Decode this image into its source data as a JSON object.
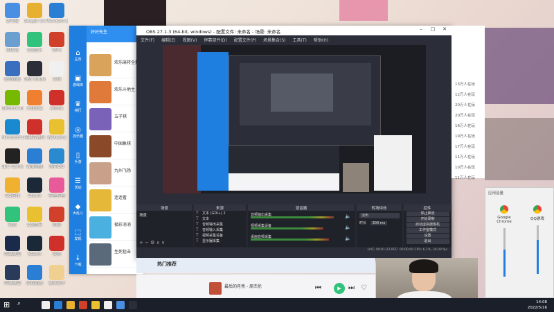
{
  "obs": {
    "title": "OBS 27.1.3 (64-bit, windows) - 配置文件: 未命名 - 场景: 未命名",
    "menu": [
      "文件(F)",
      "编辑(E)",
      "视图(V)",
      "停靠部件(D)",
      "配置文件(P)",
      "场景集合(S)",
      "工具(T)",
      "帮助(H)"
    ],
    "dock_headers": {
      "scenes": "场景",
      "sources": "来源",
      "mixer": "混音器",
      "transitions": "转场特效",
      "controls": "控件"
    },
    "scene_items": [
      "场景"
    ],
    "sources": [
      "文本 (GDI+) 2",
      "文本",
      "音频输出采集",
      "音频输入采集",
      "视频采集设备",
      "显示器采集"
    ],
    "mixer": [
      {
        "name": "音频输出采集",
        "level": 0.8
      },
      {
        "name": "视频采集设备",
        "level": 0.7
      },
      {
        "name": "桌面音频采集",
        "level": 0.75
      }
    ],
    "transition": {
      "type": "淡出",
      "duration_label": "时长",
      "duration": "300 ms"
    },
    "controls": [
      "停止推流",
      "开始录制",
      "启动虚拟摄像机",
      "工作室模式",
      "设置",
      "退出"
    ],
    "status": "LIVE: 00:01:23  REC: 00:00:00  CPU: 6.1%, 30.00 fps"
  },
  "launcher": {
    "title": "好好先生",
    "side_items": [
      {
        "icon": "home-icon",
        "glyph": "⌂",
        "label": "主页"
      },
      {
        "icon": "game-icon",
        "glyph": "▣",
        "label": "游戏库"
      },
      {
        "icon": "rank-icon",
        "glyph": "♛",
        "label": "排行"
      },
      {
        "icon": "discover-icon",
        "glyph": "◎",
        "label": "找乐趣"
      },
      {
        "icon": "phone-icon",
        "glyph": "▯",
        "label": "手游"
      },
      {
        "icon": "event-icon",
        "glyph": "☰",
        "label": "活动"
      },
      {
        "icon": "cube-icon",
        "glyph": "◆",
        "label": "大乱斗"
      },
      {
        "icon": "share-icon",
        "glyph": "⬚",
        "label": "发现"
      },
      {
        "icon": "download-icon",
        "glyph": "↓",
        "label": "下载"
      }
    ],
    "games": [
      {
        "name": "欢乐麻将全集",
        "color": "#d9a35c"
      },
      {
        "name": "欢乐斗地主",
        "color": "#e07a3a"
      },
      {
        "name": "五子棋",
        "color": "#7a62b8"
      },
      {
        "name": "中国象棋",
        "color": "#8a4a2a"
      },
      {
        "name": "九州飞扬",
        "color": "#c9a08a"
      },
      {
        "name": "连连看",
        "color": "#e6b83a"
      },
      {
        "name": "极彩消消",
        "color": "#4ab0e0"
      },
      {
        "name": "生死狙击",
        "color": "#5a6a7a"
      }
    ]
  },
  "hot": {
    "label": "热门推荐"
  },
  "music": {
    "song": "最后的月亮 - 周杰伦",
    "controls": [
      "⏮",
      "⏯",
      "⏭",
      "♡"
    ]
  },
  "rank": [
    "13万人在玩",
    "12万人在玩",
    "20万人在玩",
    "20万人在玩",
    "16万人在玩",
    "19万人在玩",
    "17万人在玩",
    "11万人在玩",
    "10万人在玩",
    "11万人在玩"
  ],
  "volume": {
    "header": "应用音量",
    "apps": [
      {
        "name": "Google Chrome",
        "level": 0.55
      },
      {
        "name": "QQ游戏",
        "level": 0.7
      }
    ]
  },
  "desktop": {
    "icons": [
      {
        "label": "此电脑",
        "color": "#4a90e2"
      },
      {
        "label": "Google Chrome",
        "color": "#e8b030"
      },
      {
        "label": "Microsoft Edge",
        "color": "#2a7fd4"
      },
      {
        "label": "回收站",
        "color": "#6a9fd0"
      },
      {
        "label": "QQ音乐",
        "color": "#31c27c"
      },
      {
        "label": "WPS",
        "color": "#d0402a"
      },
      {
        "label": "控制面板",
        "color": "#3a6fc0"
      },
      {
        "label": "OBS Studio",
        "color": "#2b2e38"
      },
      {
        "label": "文档",
        "color": "#f0f0f0"
      },
      {
        "label": "GeForce Experience",
        "color": "#76b900"
      },
      {
        "label": "火绒安全",
        "color": "#f08030"
      },
      {
        "label": "Adobe",
        "color": "#d0302a"
      },
      {
        "label": "Microsoft Edge",
        "color": "#1a8ad0"
      },
      {
        "label": "网易云音乐",
        "color": "#d0302a"
      },
      {
        "label": "WeGame",
        "color": "#e8c030"
      },
      {
        "label": "Epic Games",
        "color": "#222"
      },
      {
        "label": "百度网盘",
        "color": "#2a7fd4"
      },
      {
        "label": "腾讯QQ",
        "color": "#2a8ad0"
      },
      {
        "label": "QQ游戏",
        "color": "#f0b030"
      },
      {
        "label": "Steam",
        "color": "#1b2838"
      },
      {
        "label": "哔哩哔哩",
        "color": "#e85a9a"
      },
      {
        "label": "微信",
        "color": "#31c27c"
      },
      {
        "label": "QQ音乐",
        "color": "#e8c030"
      },
      {
        "label": "网易",
        "color": "#d0402a"
      },
      {
        "label": "英雄联盟",
        "color": "#1a2a4a"
      },
      {
        "label": "Steam",
        "color": "#1b2838"
      },
      {
        "label": "微博",
        "color": "#d0302a"
      },
      {
        "label": "英雄联盟",
        "color": "#2a3a5a"
      },
      {
        "label": "游戏加速",
        "color": "#2a7fd4"
      },
      {
        "label": "录屏文件",
        "color": "#f0d090"
      }
    ]
  },
  "taskbar": {
    "time": "14:08",
    "date": "2022/5/16",
    "apps": [
      "#f0f0f0",
      "#2a7fd4",
      "#e8b030",
      "#d0402a",
      "#e8c030",
      "#f0f0f0",
      "#4a90e2",
      "#2b2e38"
    ]
  }
}
